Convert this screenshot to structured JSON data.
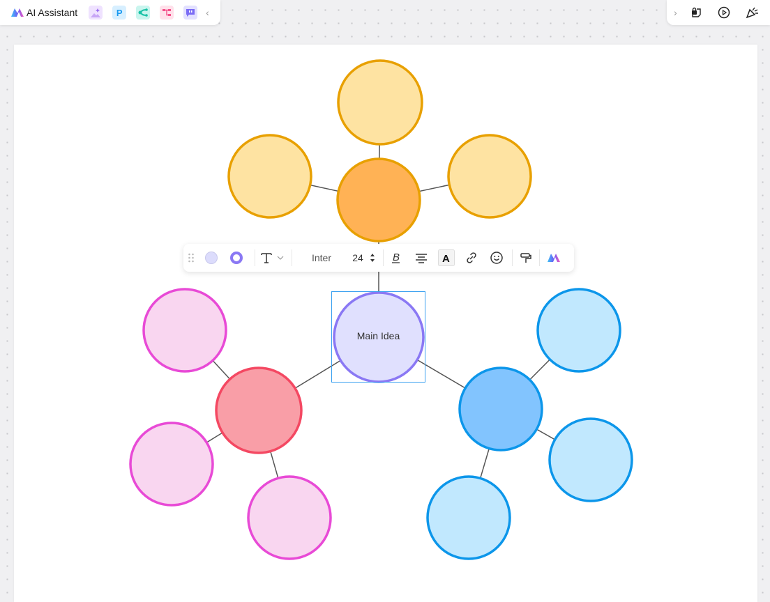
{
  "topbar": {
    "ai_assistant_label": "AI Assistant",
    "apps": [
      {
        "icon": "image-generate-icon",
        "bg": "#efe2ff",
        "fg": "#b48cf2"
      },
      {
        "icon": "presentation-p-icon",
        "bg": "#d7efff",
        "fg": "#1a9af0",
        "text": "P"
      },
      {
        "icon": "mindmap-icon",
        "bg": "#c9f5ee",
        "fg": "#19c2a6"
      },
      {
        "icon": "flowchart-icon",
        "bg": "#ffe0ea",
        "fg": "#f4508a"
      },
      {
        "icon": "chat-icon",
        "bg": "#e2e0ff",
        "fg": "#7b6cf5"
      }
    ],
    "collapse_icon": "chevron-left-icon",
    "expand_icon": "chevron-right-icon",
    "right_icons": [
      "lock-note-icon",
      "play-icon",
      "celebrate-icon"
    ]
  },
  "toolbar": {
    "fill_color": "#dcdcfc",
    "stroke_color": "#8a78f4",
    "font_name": "Inter",
    "font_size": "24",
    "icons": [
      "drag-handle-icon",
      "fill-color-icon",
      "border-color-icon",
      "text-style-icon",
      "bold-icon",
      "align-center-icon",
      "text-color-icon",
      "link-icon",
      "emoji-icon",
      "format-painter-icon",
      "ai-icon"
    ]
  },
  "diagram": {
    "main": {
      "label": "Main Idea",
      "fill": "#e0e0fe",
      "stroke": "#8a78f4",
      "selected": true
    },
    "branches": [
      {
        "name": "orange",
        "fill": "#ffb255",
        "stroke": "#e8a000",
        "child_fill": "#fee3a2",
        "child_stroke": "#e8a000",
        "children": 3
      },
      {
        "name": "red",
        "fill": "#f99ea7",
        "stroke": "#f44862",
        "child_fill": "#f9d6f0",
        "child_stroke": "#e84ad6",
        "children": 3
      },
      {
        "name": "blue",
        "fill": "#82c4fe",
        "stroke": "#0c96ea",
        "child_fill": "#c1e8fe",
        "child_stroke": "#0c96ea",
        "children": 3
      }
    ],
    "connector_color": "#555555"
  }
}
